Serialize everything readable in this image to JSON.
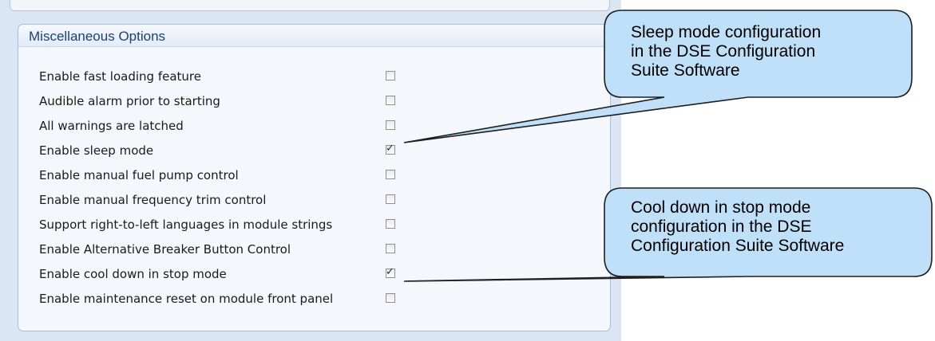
{
  "group": {
    "title": "Miscellaneous Options"
  },
  "options": [
    {
      "label": "Enable fast loading feature",
      "checked": false
    },
    {
      "label": "Audible alarm prior to starting",
      "checked": false
    },
    {
      "label": "All warnings are latched",
      "checked": false
    },
    {
      "label": "Enable sleep mode",
      "checked": true
    },
    {
      "label": "Enable manual fuel pump control",
      "checked": false
    },
    {
      "label": "Enable manual frequency trim control",
      "checked": false
    },
    {
      "label": "Support right-to-left languages in module strings",
      "checked": false
    },
    {
      "label": "Enable Alternative Breaker Button Control",
      "checked": false
    },
    {
      "label": "Enable cool down in stop mode",
      "checked": true
    },
    {
      "label": "Enable maintenance reset on module front panel",
      "checked": false
    }
  ],
  "check_glyph": "✓",
  "callouts": [
    {
      "text": "Sleep mode configuration\nin the DSE Configuration\nSuite Software",
      "target_option": "Enable sleep mode"
    },
    {
      "text": "Cool down in stop mode\nconfiguration in the DSE\nConfiguration Suite Software",
      "target_option": "Enable cool down in stop mode"
    }
  ],
  "colors": {
    "callout_fill": "#bfe0f8",
    "callout_stroke": "#1e1e1e",
    "panel_bg": "#dbe6f4",
    "title_color": "#1f3f72"
  }
}
